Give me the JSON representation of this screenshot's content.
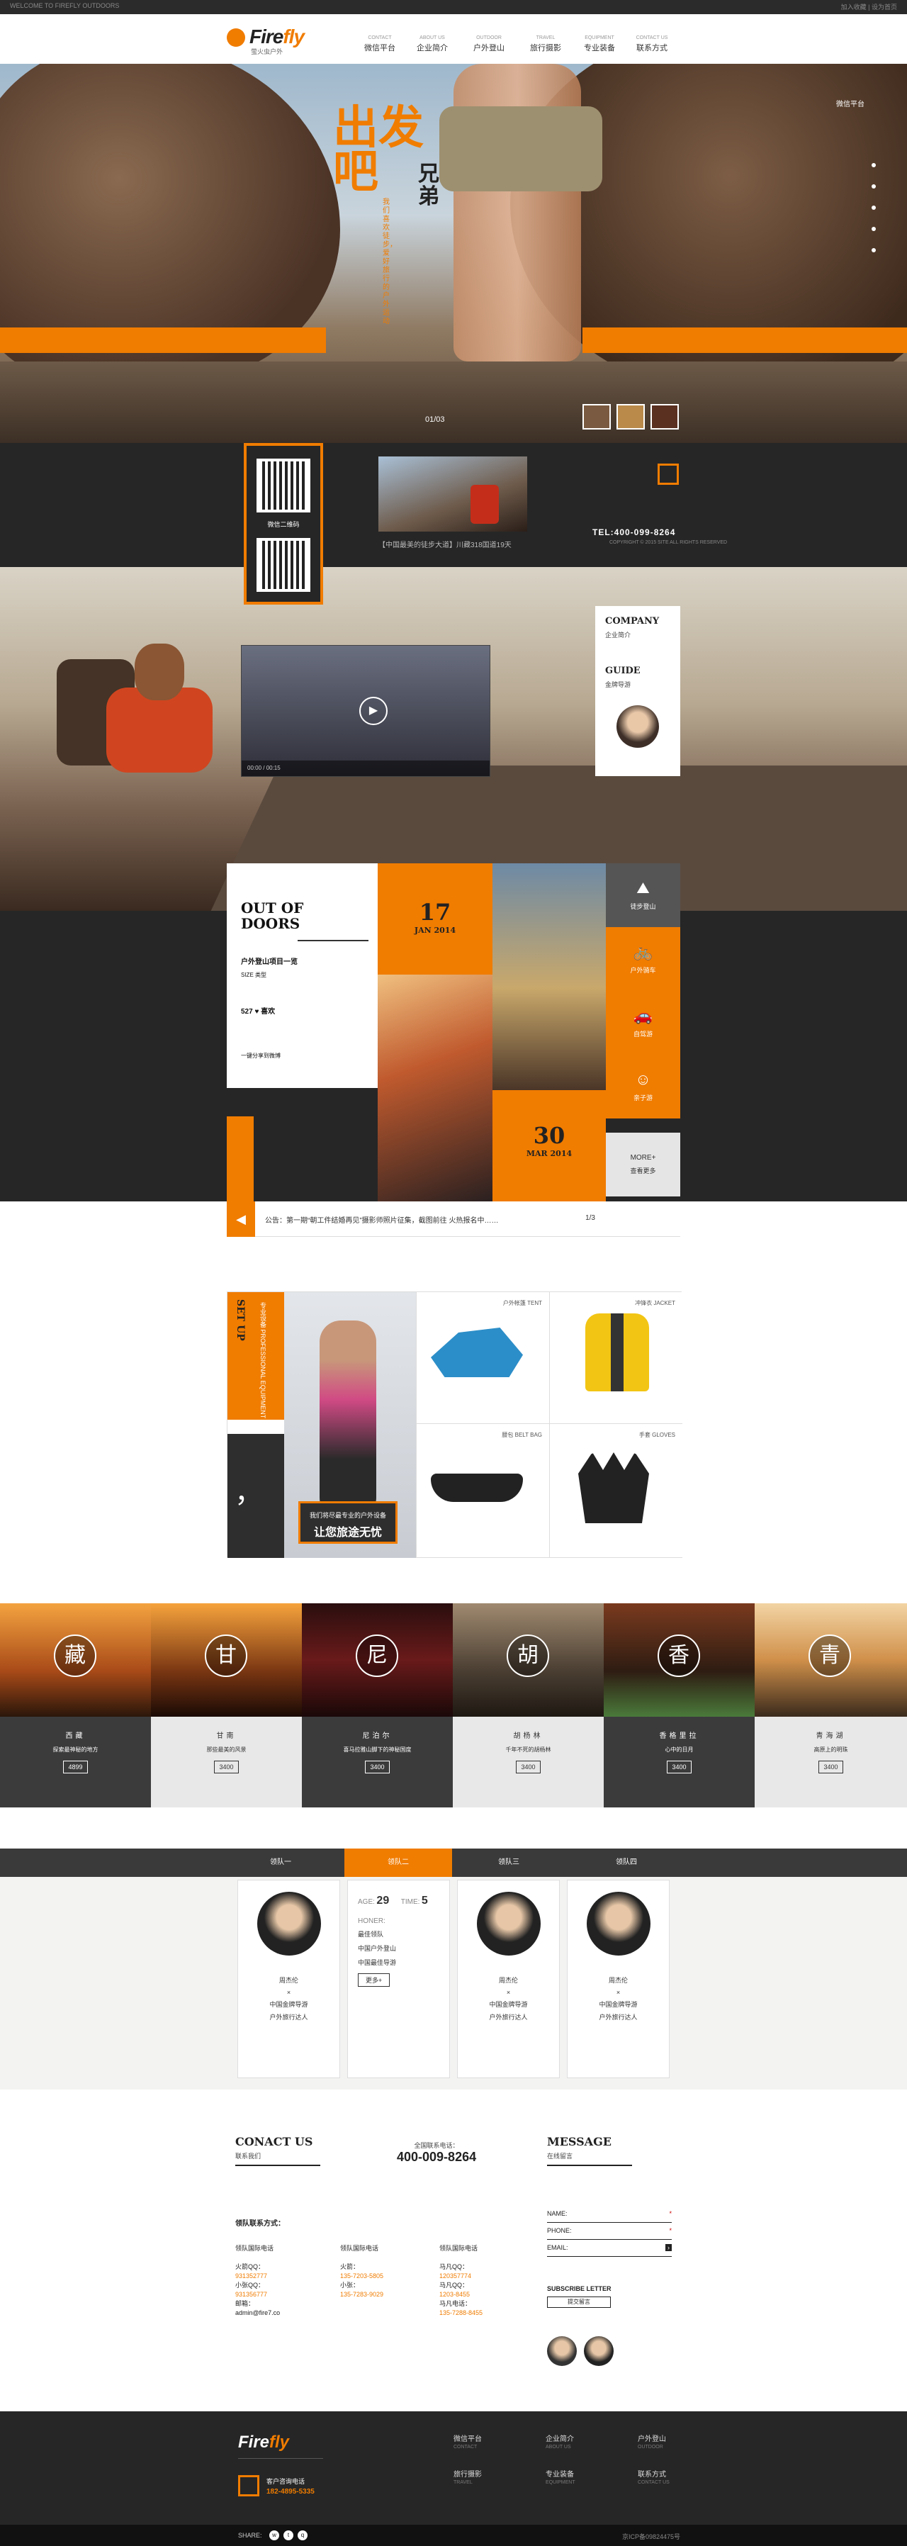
{
  "topbar": {
    "left": "WELCOME TO FIREFLY OUTDOORS",
    "right": "加入收藏  |  设为首页"
  },
  "brand": {
    "name_a": "Fire",
    "name_b": "fly",
    "sub": "萤火虫户外"
  },
  "nav": [
    {
      "en": "CONTACT",
      "cn": "微信平台"
    },
    {
      "en": "ABOUT US",
      "cn": "企业简介"
    },
    {
      "en": "OUTDOOR",
      "cn": "户外登山"
    },
    {
      "en": "TRAVEL",
      "cn": "旅行摄影"
    },
    {
      "en": "EQUIPMENT",
      "cn": "专业装备"
    },
    {
      "en": "CONTACT US",
      "cn": "联系方式"
    }
  ],
  "hero": {
    "slogan": "出发吧",
    "slogan2": "兄弟",
    "vert": "我们喜欢徒步，爱好旅行的户外运动",
    "pager": "01/03",
    "wechat": "微信平台"
  },
  "info": {
    "qr_label": "微信二维码",
    "news_caption": "【中国最美的徒步大道】川藏318国道19天",
    "tel": "TEL:400-099-8264",
    "copyright": "COPYRIGHT © 2015 SITE ALL RIGHTS RESERVED"
  },
  "video": {
    "time": "00:00 / 00:15"
  },
  "guide": {
    "h1": "COMPANY",
    "s1": "企业简介",
    "h2": "GUIDE",
    "s2": "金牌导游"
  },
  "ood": {
    "title": "OUT OF DOORS",
    "sub": "户外登山项目一览",
    "size": "SIZE 类型",
    "likes": "527 ♥ 喜欢",
    "share": "一键分享到微博"
  },
  "dates": [
    {
      "n": "17",
      "m": "JAN 2014"
    },
    {
      "n": "30",
      "m": "MAR 2014"
    }
  ],
  "icons": [
    {
      "label": "徒步登山",
      "glyph": "⛰"
    },
    {
      "label": "户外骑车",
      "glyph": "🚲"
    },
    {
      "label": "自驾游",
      "glyph": "🚗"
    },
    {
      "label": "亲子游",
      "glyph": "☺"
    }
  ],
  "more": {
    "a": "MORE+",
    "b": "查看更多"
  },
  "notice": {
    "text": "公告：第一期“朝工件结婚再见”摄影师照片征集，截图前往 火热报名中……",
    "page": "1/3"
  },
  "shop": {
    "t": "SET UP",
    "s": "专业设备 PROFESSIONAL EQUIPMENT",
    "quote": "，",
    "tag_a": "我们将尽最专业的户外设备",
    "tag_b": "让您旅途无忧",
    "items": [
      {
        "label": "户外帐篷 TENT"
      },
      {
        "label": "冲锋衣 JACKET"
      },
      {
        "label": "腰包 BELT BAG"
      },
      {
        "label": "手套 GLOVES"
      }
    ]
  },
  "dest": [
    {
      "seal": "藏",
      "name": "西藏",
      "desc": "探索最神秘的地方",
      "price": "4899"
    },
    {
      "seal": "甘",
      "name": "甘南",
      "desc": "那些最美的风景",
      "price": "3400"
    },
    {
      "seal": "尼",
      "name": "尼泊尔",
      "desc": "喜马拉雅山脚下的神秘国度",
      "price": "3400"
    },
    {
      "seal": "胡",
      "name": "胡杨林",
      "desc": "千年不死的胡杨林",
      "price": "3400"
    },
    {
      "seal": "香",
      "name": "香格里拉",
      "desc": "心中的日月",
      "price": "3400"
    },
    {
      "seal": "青",
      "name": "青海湖",
      "desc": "高原上的明珠",
      "price": "3400"
    }
  ],
  "teams": {
    "tabs": [
      "领队一",
      "领队二",
      "领队三",
      "领队四"
    ],
    "cards": [
      {
        "name": "周杰伦",
        "x": "×",
        "role": "中国金牌导游",
        "desc": "户外旅行达人"
      },
      {
        "name": "周杰伦",
        "x": "×",
        "role": "中国金牌导游",
        "desc": "户外旅行达人"
      },
      {
        "name": "周杰伦",
        "x": "×",
        "role": "中国金牌导游",
        "desc": "户外旅行达人"
      }
    ],
    "detail": {
      "age_k": "AGE:",
      "age_v": "29",
      "time_k": "TIME:",
      "time_v": "5",
      "honor": "HONER:",
      "h1": "最佳领队",
      "h2": "中国户外登山",
      "h3": "中国最佳导游",
      "btn": "更多+"
    }
  },
  "contact": {
    "h": "CONACT US",
    "s": "联系我们",
    "phone_lbl": "全国联系电话：",
    "phone": "400-009-8264",
    "team_h": "领队联系方式：",
    "cols": [
      {
        "t": "领队国际电话",
        "a": "火箭QQ：",
        "av": "931352777",
        "b": "小张QQ：",
        "bv": "931356777",
        "c": "邮箱：",
        "cv": "admin@fire7.co"
      },
      {
        "t": "领队国际电话",
        "a": "火箭：",
        "av": "135-7203-5805",
        "b": "小张：",
        "bv": "135-7283-9029"
      },
      {
        "t": "领队国际电话",
        "a": "马凡QQ：",
        "av": "120357774",
        "b": "马凡QQ：",
        "bv": "1203-8455",
        "c": "马凡电话：",
        "cv": "135-7288-8455"
      }
    ],
    "msg_h": "MESSAGE",
    "msg_s": "在线留言",
    "name": "NAME:",
    "phone_f": "PHONE:",
    "email": "EMAIL:",
    "sub": "SUBSCRIBE LETTER",
    "sub_btn": "提交留言"
  },
  "footer": {
    "a": "Fire",
    "b": "fly",
    "ct": "客户咨询电话",
    "tel": "182-4895-5335",
    "links": [
      {
        "cn": "微信平台",
        "en": "CONTACT"
      },
      {
        "cn": "企业简介",
        "en": "ABOUT US"
      },
      {
        "cn": "户外登山",
        "en": "OUTDOOR"
      },
      {
        "cn": "旅行摄影",
        "en": "TRAVEL"
      },
      {
        "cn": "专业装备",
        "en": "EQUIPMENT"
      },
      {
        "cn": "联系方式",
        "en": "CONTACT US"
      }
    ],
    "share": "SHARE:",
    "icp": "京ICP备09824475号"
  },
  "colors": {
    "accent": "#f07c00",
    "dark": "#262626"
  }
}
